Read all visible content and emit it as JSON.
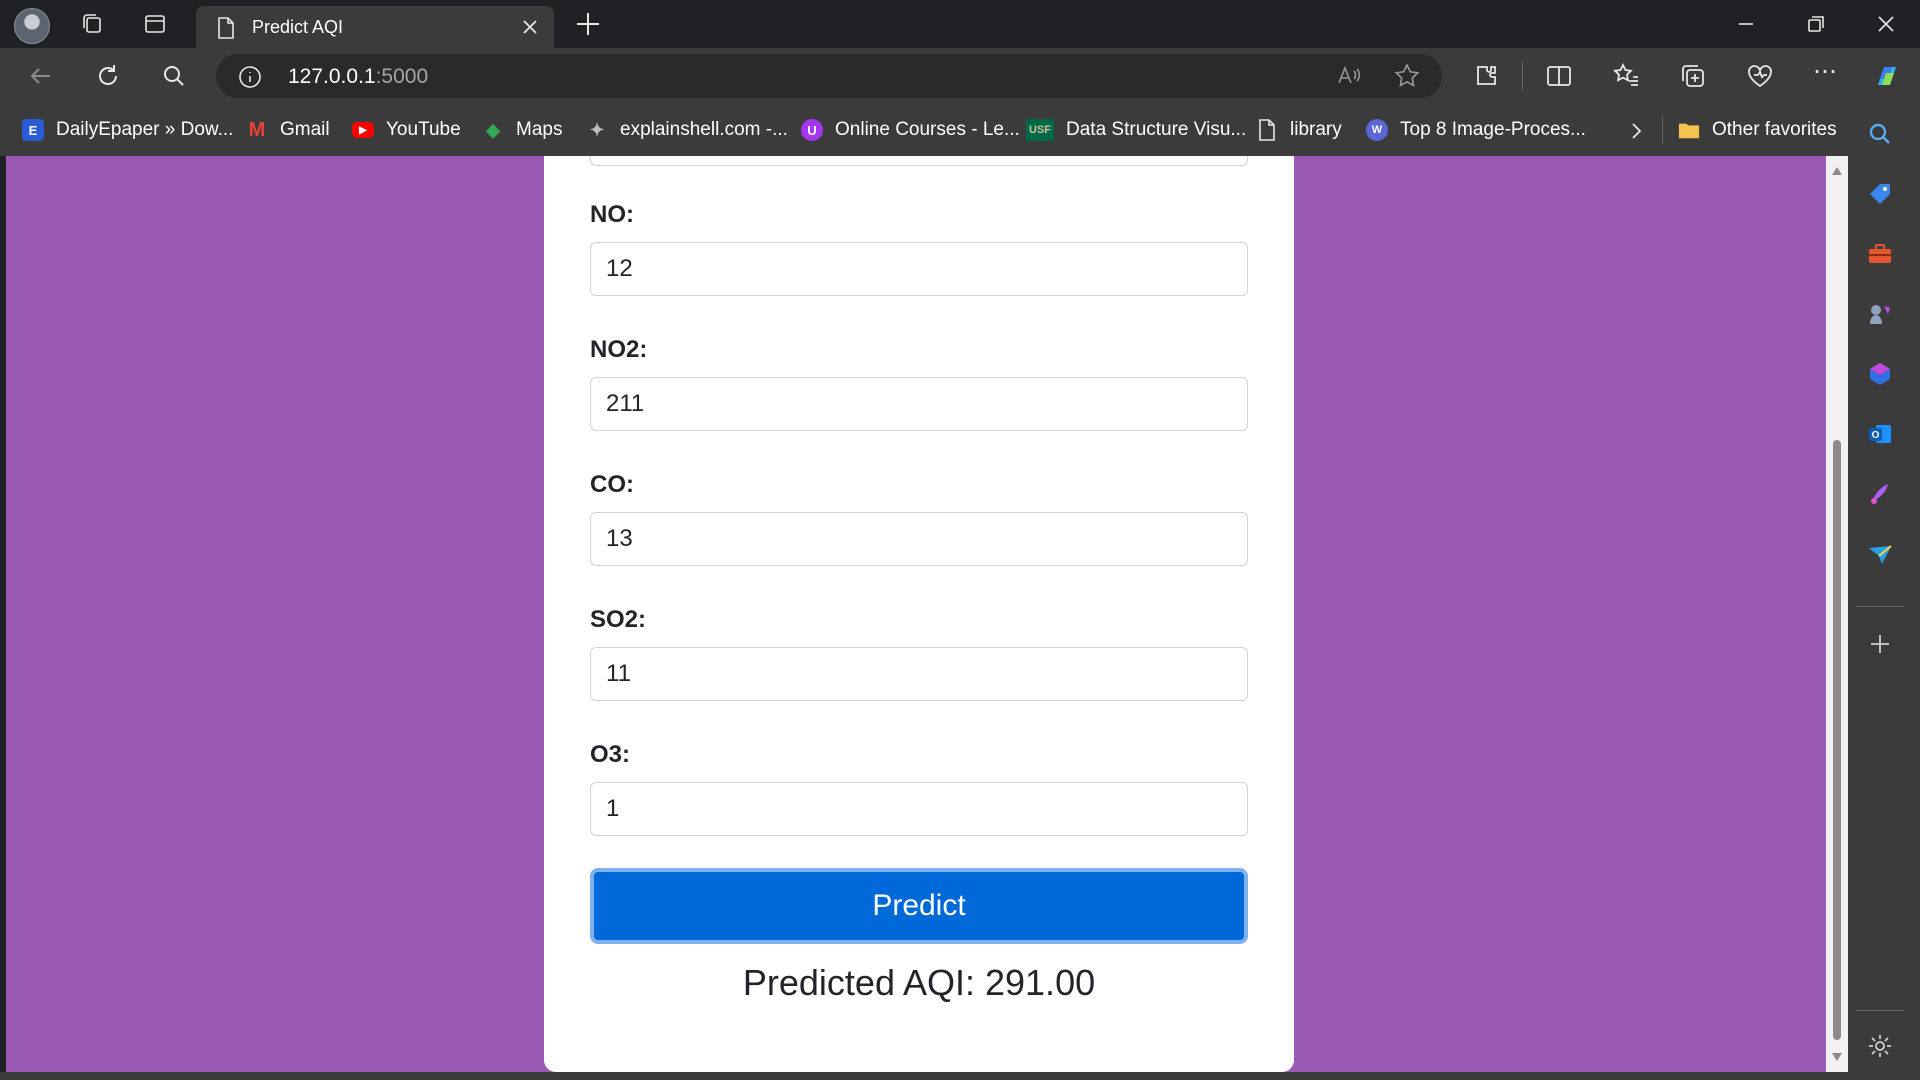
{
  "browser": {
    "tab_title": "Predict AQI",
    "url_host": "127.0.0.1",
    "url_port": ":5000"
  },
  "bookmarks": [
    {
      "label": "DailyEpaper » Dow...",
      "icon": "e-icon",
      "color": "#2b5bd7",
      "glyph": "E"
    },
    {
      "label": "Gmail",
      "icon": "gmail-icon",
      "color": "#ea4335",
      "glyph": "M"
    },
    {
      "label": "YouTube",
      "icon": "youtube-icon",
      "color": "#ff0000",
      "glyph": "▶"
    },
    {
      "label": "Maps",
      "icon": "maps-icon",
      "color": "#34a853",
      "glyph": "◆"
    },
    {
      "label": "explainshell.com -...",
      "icon": "explainshell-icon",
      "color": "#555555",
      "glyph": "✦"
    },
    {
      "label": "Online Courses - Le...",
      "icon": "udemy-icon",
      "color": "#a435f0",
      "glyph": "U"
    },
    {
      "label": "Data Structure Visu...",
      "icon": "usf-icon",
      "color": "#006747",
      "glyph": "USF"
    },
    {
      "label": "library",
      "icon": "document-icon",
      "color": "#3b3b3b",
      "glyph": ""
    },
    {
      "label": "Top 8 Image-Proces...",
      "icon": "wave-icon",
      "color": "#5a67d8",
      "glyph": "W"
    }
  ],
  "other_favorites": "Other favorites",
  "form": {
    "fields": [
      {
        "label": "NO:",
        "value": "12"
      },
      {
        "label": "NO2:",
        "value": "211"
      },
      {
        "label": "CO:",
        "value": "13"
      },
      {
        "label": "SO2:",
        "value": "11"
      },
      {
        "label": "O3:",
        "value": "1"
      }
    ],
    "submit_label": "Predict",
    "result_text": "Predicted AQI: 291.00"
  },
  "colors": {
    "page_background": "#9b59b6",
    "button": "#0069d9"
  }
}
